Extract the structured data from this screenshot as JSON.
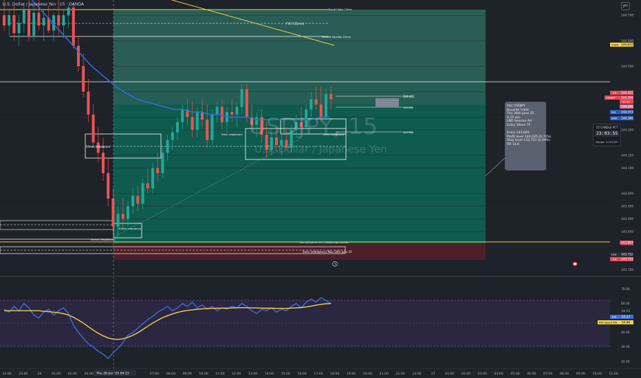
{
  "header": {
    "symbol_title": "U.S. Dollar / Japanese Yen · 15 · OANDA"
  },
  "watermark": {
    "ticker": "USDJPY, 15",
    "name": "U.S. Dollar / Japanese Yen"
  },
  "currency_button": "JPY",
  "price_scale": {
    "ticks": [
      "144.700",
      "144.600",
      "144.500",
      "144.400",
      "144.300",
      "144.250",
      "144.150",
      "144.100",
      "144.000",
      "143.950",
      "143.900",
      "143.850",
      "143.800",
      "143.700"
    ]
  },
  "price_tags": {
    "mlow": "mlow",
    "mlow_val": "144.672",
    "aa1": "AA",
    "aa1_val": "144.421",
    "sym": "USDJPY",
    "sym_val": "144.396",
    "sym_sub": "01:51",
    "bid": "Bid",
    "bid_val": "144.373",
    "ask": "EMA",
    "ask_val": "144.346",
    "pink1": "144.291",
    "red_val": "143.883",
    "low": "Low",
    "low_val": "143.752",
    "aa2": "AA",
    "aa2_val": "143.733"
  },
  "rsi_scale": {
    "ticks": [
      "70.00",
      "60.00",
      "50.00",
      "40.00",
      "30.00",
      "20.00"
    ]
  },
  "rsi_tags": {
    "rsi": "RSI",
    "rsi_val": "55.27",
    "rsi_val2": "66.66",
    "base": "RSI-based MA",
    "base_val": "54.66"
  },
  "time_axis": {
    "labels": [
      "22:00",
      "23:00",
      "26",
      "01:00",
      "02:00",
      "03:00",
      "04:00",
      "05:00",
      "06:00",
      "07:00",
      "08:00",
      "09:00",
      "10:00",
      "11:00",
      "12:00",
      "13:00",
      "14:00",
      "15:00",
      "16:00",
      "17:00",
      "18:00",
      "19:00",
      "20:00",
      "21:00",
      "22:00",
      "23:00",
      "27",
      "01:00",
      "02:00",
      "03:00",
      "04:00",
      "05:00",
      "06:00",
      "07:00",
      "08:00",
      "09:00",
      "10:00",
      "11:00"
    ],
    "cursor_label": "Thu 26 Jun '25  04:15"
  },
  "annotations": {
    "equal_highs": "Equal Highs 15min",
    "fvg": "FVG (15min)",
    "sellside": "Sellside liquidity 15min",
    "imb15": "15min imbalance",
    "imb5": "5min imbalance",
    "imb30": "30min imbalance",
    "imb5b": "5min imbalance",
    "imb30b": "30min (imbalance)",
    "imb5_mon": "5min (imbalance) Mon 16th June 25",
    "tgt1": "144.402",
    "tgt2": "144.396",
    "tgt3": "144.388",
    "small_note": "Hour 15m June 25 (4 H ~) Premium tape sold lows"
  },
  "position_box": {
    "lines": [
      "Pair USDJPY",
      "Buyside trade",
      "Thu 26th June 25",
      "4.15 am",
      "LND Session AA",
      "Entry 30sec TF",
      "",
      "Entry 143.883",
      "Profit level 144.625 (0.71%)",
      "Stop level 143.733 (0.09%)",
      "RR 14.6"
    ]
  },
  "timer": {
    "title": "15 CANDLE PCT",
    "time": "23:03:55",
    "range": "Range: 0.199 JPY"
  },
  "chart_data": {
    "type": "candlestick",
    "title": "U.S. Dollar / Japanese Yen · 15 · OANDA",
    "timeframe": "15m",
    "price_range": [
      143.68,
      144.76
    ],
    "ohlc": [
      [
        144.7,
        144.76,
        144.64,
        144.66
      ],
      [
        144.66,
        144.72,
        144.62,
        144.7
      ],
      [
        144.7,
        144.74,
        144.6,
        144.63
      ],
      [
        144.63,
        144.7,
        144.58,
        144.67
      ],
      [
        144.67,
        144.75,
        144.63,
        144.72
      ],
      [
        144.72,
        144.76,
        144.6,
        144.62
      ],
      [
        144.62,
        144.74,
        144.6,
        144.71
      ],
      [
        144.71,
        144.76,
        144.64,
        144.66
      ],
      [
        144.66,
        144.72,
        144.6,
        144.69
      ],
      [
        144.69,
        144.74,
        144.63,
        144.64
      ],
      [
        144.64,
        144.71,
        144.6,
        144.7
      ],
      [
        144.7,
        144.76,
        144.62,
        144.66
      ],
      [
        144.66,
        144.72,
        144.61,
        144.7
      ],
      [
        144.7,
        144.74,
        144.65,
        144.73
      ],
      [
        144.73,
        144.75,
        144.57,
        144.58
      ],
      [
        144.58,
        144.62,
        144.48,
        144.5
      ],
      [
        144.5,
        144.55,
        144.38,
        144.4
      ],
      [
        144.4,
        144.45,
        144.28,
        144.31
      ],
      [
        144.31,
        144.35,
        144.18,
        144.2
      ],
      [
        144.2,
        144.26,
        144.12,
        144.16
      ],
      [
        144.16,
        144.22,
        144.05,
        144.08
      ],
      [
        144.08,
        144.14,
        143.95,
        143.98
      ],
      [
        143.98,
        144.02,
        143.85,
        143.87
      ],
      [
        143.87,
        143.95,
        143.83,
        143.92
      ],
      [
        143.92,
        143.98,
        143.86,
        143.9
      ],
      [
        143.9,
        143.97,
        143.87,
        143.95
      ],
      [
        143.95,
        144.02,
        143.92,
        143.99
      ],
      [
        143.99,
        144.03,
        143.93,
        143.96
      ],
      [
        143.96,
        144.06,
        143.94,
        144.04
      ],
      [
        144.04,
        144.1,
        144.0,
        144.02
      ],
      [
        144.02,
        144.12,
        144.0,
        144.1
      ],
      [
        144.1,
        144.16,
        144.05,
        144.08
      ],
      [
        144.08,
        144.18,
        144.06,
        144.16
      ],
      [
        144.16,
        144.23,
        144.13,
        144.21
      ],
      [
        144.21,
        144.26,
        144.17,
        144.24
      ],
      [
        144.24,
        144.3,
        144.21,
        144.28
      ],
      [
        144.28,
        144.35,
        144.25,
        144.33
      ],
      [
        144.33,
        144.37,
        144.27,
        144.3
      ],
      [
        144.3,
        144.36,
        144.22,
        144.25
      ],
      [
        144.25,
        144.34,
        144.22,
        144.32
      ],
      [
        144.32,
        144.37,
        144.26,
        144.29
      ],
      [
        144.29,
        144.35,
        144.18,
        144.21
      ],
      [
        144.21,
        144.33,
        144.19,
        144.31
      ],
      [
        144.31,
        144.36,
        144.28,
        144.34
      ],
      [
        144.34,
        144.37,
        144.25,
        144.28
      ],
      [
        144.28,
        144.34,
        144.24,
        144.32
      ],
      [
        144.32,
        144.37,
        144.28,
        144.31
      ],
      [
        144.31,
        144.36,
        144.26,
        144.34
      ],
      [
        144.34,
        144.43,
        144.31,
        144.41
      ],
      [
        144.41,
        144.43,
        144.28,
        144.3
      ],
      [
        144.3,
        144.35,
        144.24,
        144.27
      ],
      [
        144.27,
        144.32,
        144.22,
        144.3
      ],
      [
        144.3,
        144.33,
        144.2,
        144.23
      ],
      [
        144.23,
        144.28,
        144.14,
        144.17
      ],
      [
        144.17,
        144.25,
        144.15,
        144.22
      ],
      [
        144.22,
        144.26,
        144.16,
        144.19
      ],
      [
        144.19,
        144.24,
        144.15,
        144.21
      ],
      [
        144.21,
        144.26,
        144.17,
        144.18
      ],
      [
        144.18,
        144.27,
        144.16,
        144.25
      ],
      [
        144.25,
        144.31,
        144.22,
        144.28
      ],
      [
        144.28,
        144.34,
        144.24,
        144.26
      ],
      [
        144.26,
        144.35,
        144.25,
        144.33
      ],
      [
        144.33,
        144.4,
        144.3,
        144.37
      ],
      [
        144.37,
        144.42,
        144.33,
        144.35
      ],
      [
        144.35,
        144.42,
        144.28,
        144.3
      ],
      [
        144.3,
        144.41,
        144.28,
        144.39
      ],
      [
        144.39,
        144.42,
        144.33,
        144.37
      ]
    ],
    "ma": [
      144.78,
      144.74,
      144.7,
      144.66,
      144.62,
      144.58,
      144.54,
      144.5,
      144.47,
      144.44,
      144.41,
      144.39,
      144.37,
      144.36,
      144.35,
      144.34,
      144.33,
      144.33,
      144.32,
      144.32,
      144.31,
      144.31,
      144.3,
      144.3,
      144.3,
      144.29,
      144.29,
      144.29,
      144.29,
      144.29,
      144.29,
      144.29,
      144.3,
      144.3
    ],
    "rsi": {
      "ticks": [
        70,
        60,
        50,
        40,
        30,
        20
      ],
      "range": [
        18,
        75
      ],
      "rsi": [
        56,
        54,
        58,
        55,
        60,
        57,
        52,
        50,
        54,
        56,
        52,
        55,
        57,
        53,
        45,
        40,
        36,
        32,
        30,
        27,
        25,
        22,
        26,
        29,
        33,
        38,
        40,
        43,
        46,
        49,
        51,
        54,
        56,
        58,
        55,
        57,
        60,
        58,
        61,
        57,
        59,
        56,
        58,
        55,
        57,
        56,
        58,
        57,
        60,
        58,
        55,
        53,
        56,
        55,
        57,
        54,
        56,
        55,
        58,
        60,
        57,
        61,
        63,
        61,
        64,
        62,
        60
      ],
      "ma": [
        55,
        55,
        55,
        55,
        55,
        55,
        55,
        55,
        54.6,
        54.3,
        54,
        53.6,
        53,
        52,
        50.5,
        48.6,
        46.4,
        44,
        41.6,
        39.4,
        37.6,
        36.2,
        35.4,
        35.2,
        35.6,
        36.6,
        38,
        39.8,
        42,
        44.2,
        46.4,
        48.4,
        50.2,
        51.6,
        52.8,
        53.8,
        54.6,
        55.2,
        55.6,
        56,
        56.3,
        56.5,
        56.6,
        56.7,
        56.8,
        56.8,
        56.9,
        57,
        57.1,
        57.1,
        57,
        56.9,
        56.8,
        56.7,
        56.7,
        56.6,
        56.6,
        56.6,
        56.8,
        57,
        57.2,
        57.6,
        58.2,
        58.8,
        59.4,
        59.8,
        60
      ]
    }
  }
}
